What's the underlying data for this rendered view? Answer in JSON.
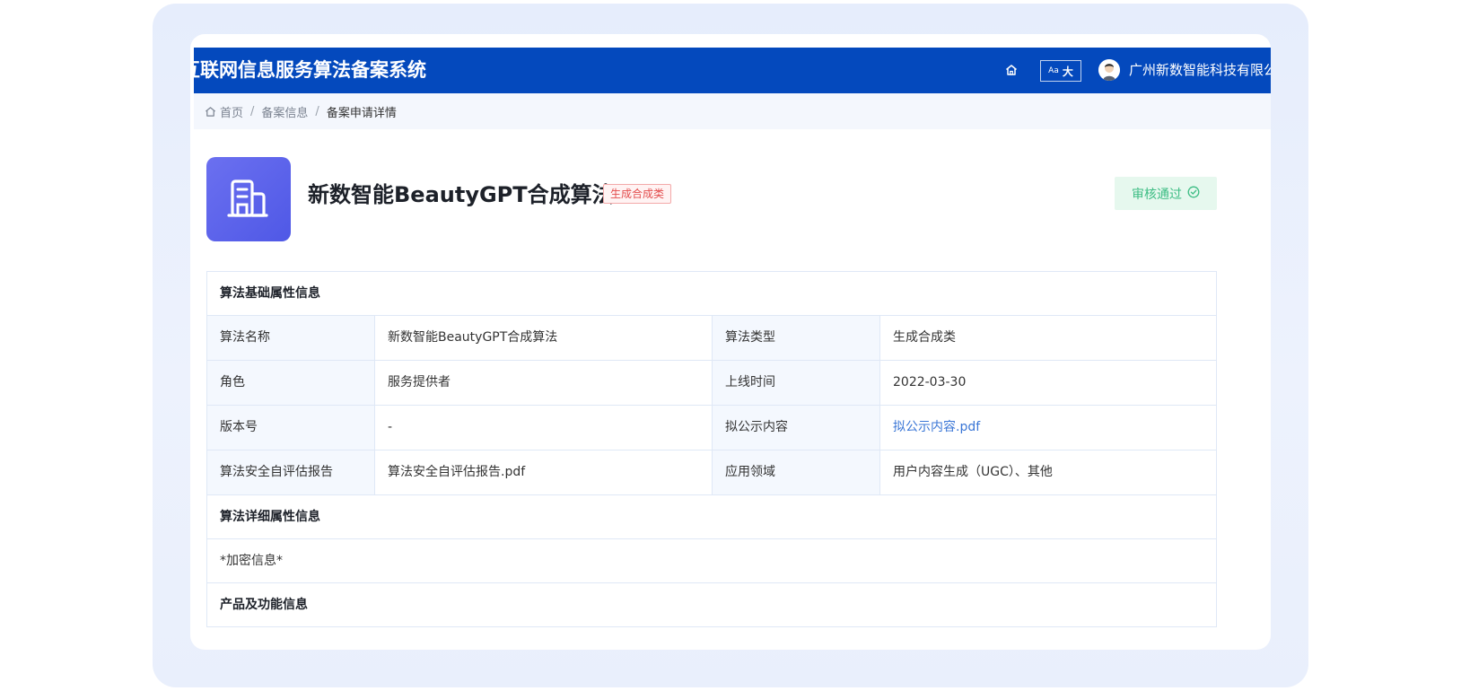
{
  "header": {
    "system_title": "互联网信息服务算法备案系统",
    "font_toggle": {
      "small": "Aa",
      "big": "大"
    },
    "company_name": "广州新数智能科技有限公司"
  },
  "breadcrumb": {
    "items": [
      "首页",
      "备案信息"
    ],
    "separator": "/",
    "current": "备案申请详情"
  },
  "algorithm": {
    "title": "新数智能BeautyGPT合成算法",
    "type_tag": "生成合成类",
    "status": "审核通过"
  },
  "basic_info": {
    "section_title": "算法基础属性信息",
    "rows": [
      [
        "算法名称",
        "新数智能BeautyGPT合成算法",
        "算法类型",
        "生成合成类"
      ],
      [
        "角色",
        "服务提供者",
        "上线时间",
        "2022-03-30"
      ],
      [
        "版本号",
        "-",
        "拟公示内容",
        "拟公示内容.pdf"
      ],
      [
        "算法安全自评估报告",
        "算法安全自评估报告.pdf",
        "应用领域",
        "用户内容生成（UGC）、其他"
      ]
    ]
  },
  "detail_info": {
    "section_title": "算法详细属性信息",
    "encrypted": "*加密信息*"
  },
  "product_info": {
    "section_title": "产品及功能信息"
  },
  "colors": {
    "header_bg": "#0449bd",
    "icon_bg": "#5b62eb",
    "status_green": "#3dbd84",
    "tag_red": "#e34d4d",
    "link_blue": "#3a76d6"
  }
}
